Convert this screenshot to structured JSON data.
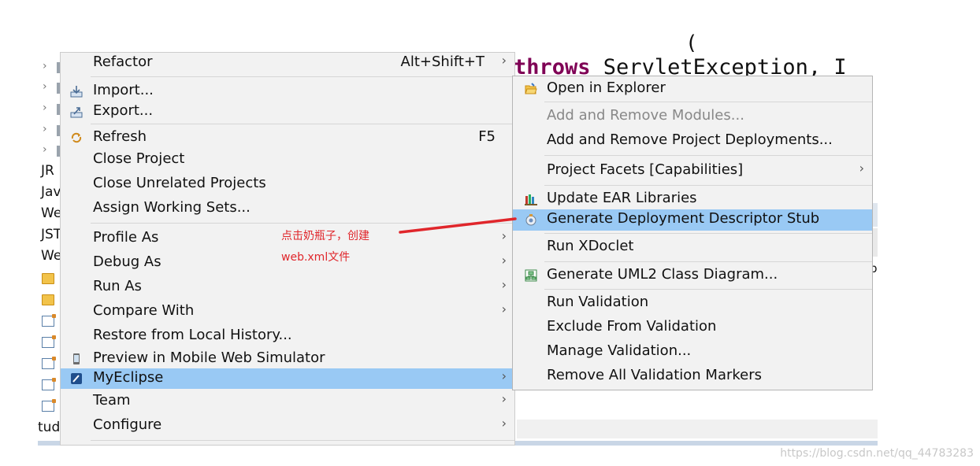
{
  "tree": {
    "items": [
      "JR",
      "Jav",
      "We",
      "JST",
      "We"
    ],
    "bottom_text": "tud"
  },
  "editor": {
    "line1": "(   ",
    "keyword": "throws",
    "rest": " ServletException, I"
  },
  "right_text": "p",
  "menu": {
    "refactor": {
      "label": "Refactor",
      "accel": "Alt+Shift+T"
    },
    "import": "Import...",
    "export": "Export...",
    "refresh": {
      "label": "Refresh",
      "accel": "F5"
    },
    "close_project": "Close Project",
    "close_unrelated": "Close Unrelated Projects",
    "assign_working_sets": "Assign Working Sets...",
    "profile_as": "Profile As",
    "debug_as": "Debug As",
    "run_as": "Run As",
    "compare_with": "Compare With",
    "restore_history": "Restore from Local History...",
    "preview_mobile": "Preview in Mobile Web Simulator",
    "myeclipse": "MyEclipse",
    "team": "Team",
    "configure": "Configure",
    "arrow": "›"
  },
  "submenu": {
    "open_explorer": "Open in Explorer",
    "add_remove_modules": "Add and Remove Modules...",
    "add_remove_deployments": "Add and Remove Project Deployments...",
    "project_facets": "Project Facets [Capabilities]",
    "update_ear": "Update EAR Libraries",
    "generate_stub": "Generate Deployment Descriptor Stub",
    "run_xdoclet": "Run XDoclet",
    "generate_uml": "Generate UML2 Class Diagram...",
    "run_validation": "Run Validation",
    "exclude_validation": "Exclude From Validation",
    "manage_validation": "Manage Validation...",
    "remove_markers": "Remove All Validation Markers"
  },
  "annotation": {
    "line1": "点击奶瓶子，创建",
    "line2": "web.xml文件",
    "color": "#e0262b"
  },
  "watermark": "https://blog.csdn.net/qq_44783283",
  "colors": {
    "highlight": "#99c9f4",
    "menu_bg": "#f2f2f2",
    "keyword": "#7f0055"
  }
}
